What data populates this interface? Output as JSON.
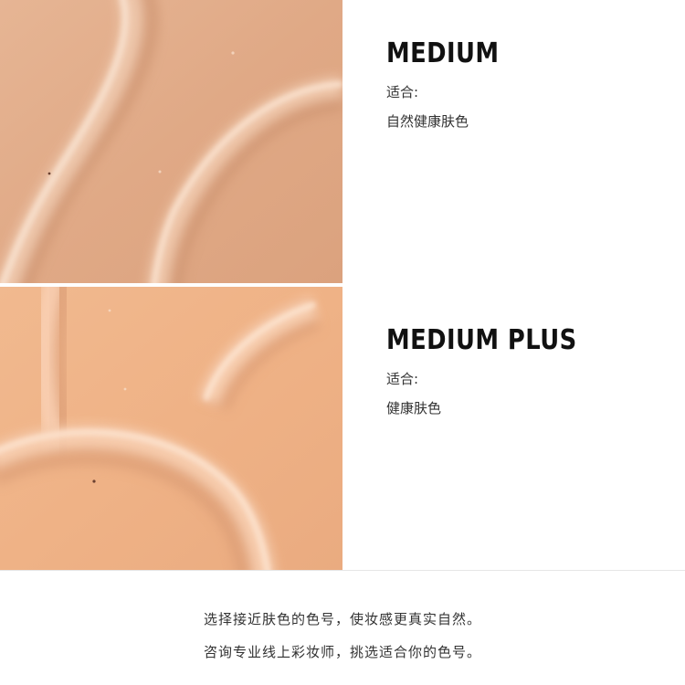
{
  "shades": [
    {
      "name": "MEDIUM",
      "suit_label": "适合:",
      "suit_value": "自然健康肤色",
      "color": "#e2ad8a"
    },
    {
      "name": "MEDIUM PLUS",
      "suit_label": "适合:",
      "suit_value": "健康肤色",
      "color": "#eeb286"
    }
  ],
  "footer": {
    "line1": "选择接近肤色的色号，使妆感更真实自然。",
    "line2": "咨询专业线上彩妆师，挑选适合你的色号。"
  }
}
